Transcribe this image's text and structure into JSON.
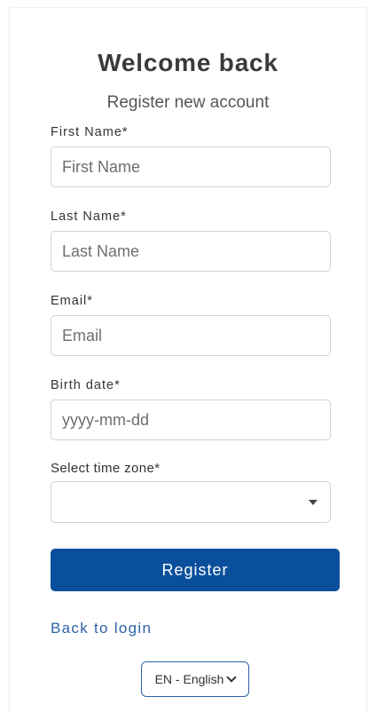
{
  "header": {
    "title": "Welcome back",
    "subtitle": "Register new account"
  },
  "form": {
    "first_name": {
      "label": "First Name*",
      "placeholder": "First Name",
      "value": ""
    },
    "last_name": {
      "label": "Last Name*",
      "placeholder": "Last Name",
      "value": ""
    },
    "email": {
      "label": "Email*",
      "placeholder": "Email",
      "value": ""
    },
    "birth_date": {
      "label": "Birth date*",
      "placeholder": "yyyy-mm-dd",
      "value": ""
    },
    "time_zone": {
      "label": "Select time zone*",
      "selected": ""
    },
    "register_label": "Register"
  },
  "footer": {
    "back_to_login": "Back to login",
    "language": "EN - English"
  },
  "icons": {
    "time_zone_caret": "caret-down-icon",
    "language_chevron": "chevron-down-icon"
  },
  "colors": {
    "primary": "#0a4f9c",
    "link": "#2d62a6",
    "border": "#cfd2d5"
  }
}
